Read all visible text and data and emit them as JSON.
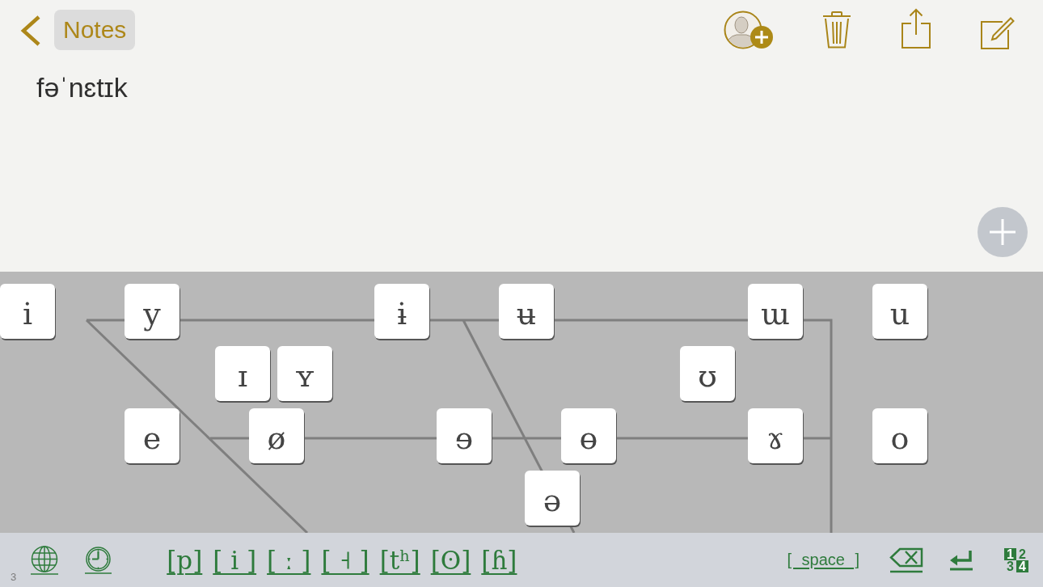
{
  "nav_bar": {
    "back_button": "Notes"
  },
  "note": {
    "text": "fəˈnɛtɪk"
  },
  "vowel_chart": {
    "rows": [
      [
        "i",
        "y",
        "ɨ",
        "ʉ",
        "ɯ",
        "u"
      ],
      [
        "ɪ",
        "ʏ",
        "ʊ"
      ],
      [
        "e",
        "ø",
        "ɘ",
        "ɵ",
        "ɤ",
        "o"
      ],
      [
        "ə"
      ]
    ]
  },
  "toolbar": {
    "corner_label": "3",
    "symbol_keys": [
      "[p]",
      "[ i ]",
      "[ ː ]",
      "[ ˧ ]",
      "[tʰ]",
      "[ʘ]",
      "[ɦ]"
    ],
    "space_key": "[ space ]",
    "numbers_key": [
      {
        "digit": "1",
        "filled": true
      },
      {
        "digit": "2",
        "filled": false
      },
      {
        "digit": "3",
        "filled": false
      },
      {
        "digit": "4",
        "filled": true
      }
    ]
  }
}
